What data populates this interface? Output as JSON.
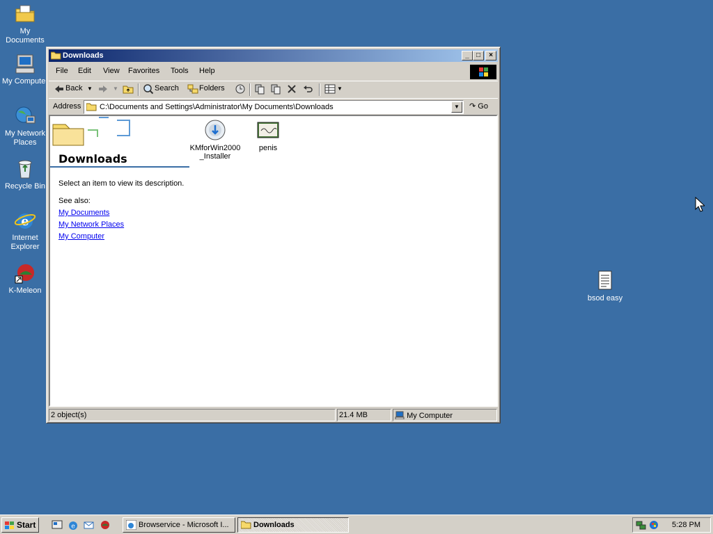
{
  "desktop": {
    "icons": [
      {
        "label": "My Documents"
      },
      {
        "label": "My Computer"
      },
      {
        "label": "My Network Places"
      },
      {
        "label": "Recycle Bin"
      },
      {
        "label": "Internet Explorer"
      },
      {
        "label": "K-Meleon"
      },
      {
        "label": "bsod easy"
      }
    ]
  },
  "window": {
    "title": "Downloads",
    "menu": [
      "File",
      "Edit",
      "View",
      "Favorites",
      "Tools",
      "Help"
    ],
    "toolbar": {
      "back": "Back",
      "search": "Search",
      "folders": "Folders"
    },
    "address": {
      "label": "Address",
      "path": "C:\\Documents and Settings\\Administrator\\My Documents\\Downloads",
      "go": "Go"
    },
    "sidebar": {
      "title": "Downloads",
      "description": "Select an item to view its description.",
      "see_also": "See also:",
      "links": [
        "My Documents",
        "My Network Places",
        "My Computer"
      ]
    },
    "files": [
      {
        "name": "KMforWin2000_Installer",
        "line1": "KMforWin2000",
        "line2": "_Installer",
        "icon": "installer-icon"
      },
      {
        "name": "penis",
        "line1": "penis",
        "line2": "",
        "icon": "image-file-icon"
      }
    ],
    "status": {
      "objects": "2 object(s)",
      "size": "21.4 MB",
      "zone": "My Computer"
    }
  },
  "taskbar": {
    "start": "Start",
    "tasks": [
      {
        "label": "Browservice - Microsoft I...",
        "active": false
      },
      {
        "label": "Downloads",
        "active": true
      }
    ],
    "clock": "5:28 PM"
  },
  "colors": {
    "desktop": "#3a6ea5",
    "titlebar_start": "#0a246a",
    "titlebar_end": "#a6caf0",
    "chrome": "#d4d0c8",
    "link": "#0000ee"
  }
}
